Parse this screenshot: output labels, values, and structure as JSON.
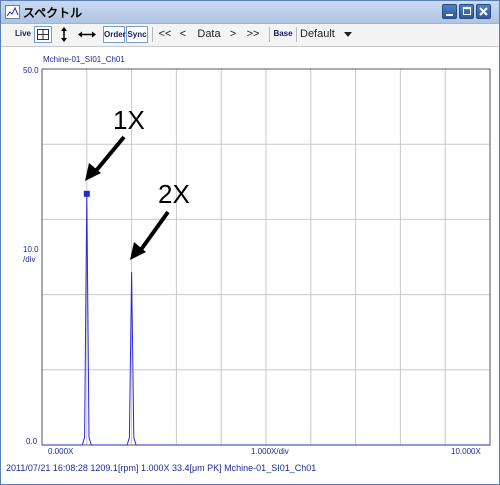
{
  "window": {
    "title": "スペクトル"
  },
  "toolbar": {
    "live_label": "Live",
    "order_label": "Order",
    "sync_label": "Sync",
    "first_label": "<<",
    "prev_label": "<",
    "data_label": "Data",
    "next_label": ">",
    "last_label": ">>",
    "base_label": "Base",
    "preset_value": "Default"
  },
  "chart": {
    "channel": "Mchine-01_SI01_Ch01",
    "y_top_label": "50.0",
    "y_mid_label": "10.0",
    "y_unit": "/div",
    "y_zero_label": "0.0",
    "x_min_label": "0.000X",
    "x_div_label": "1.000X/div",
    "x_max_label": "10.000X",
    "annotation_1x": "1X",
    "annotation_2x": "2X"
  },
  "chart_data": {
    "type": "line",
    "series": [
      {
        "name": "Mchine-01_SI01_Ch01",
        "x": [
          0.0,
          0.9,
          0.95,
          1.0,
          1.05,
          1.1,
          1.9,
          1.95,
          2.0,
          2.05,
          2.1,
          3.0,
          10.0
        ],
        "y": [
          0.0,
          0.0,
          1.0,
          33.4,
          1.0,
          0.0,
          0.0,
          1.0,
          23.0,
          1.0,
          0.0,
          0.0,
          0.0
        ]
      }
    ],
    "xlim": [
      0,
      10
    ],
    "ylim": [
      0,
      50
    ],
    "grid": true
  },
  "status": {
    "text": "2011/07/21 16:08:28 1209.1[rpm]   1.000X 33.4[μm PK] Mchine-01_SI01_Ch01"
  },
  "colors": {
    "trace": "#2a2ad8",
    "text": "#1a2a9a",
    "grid": "#c8c8c8"
  }
}
